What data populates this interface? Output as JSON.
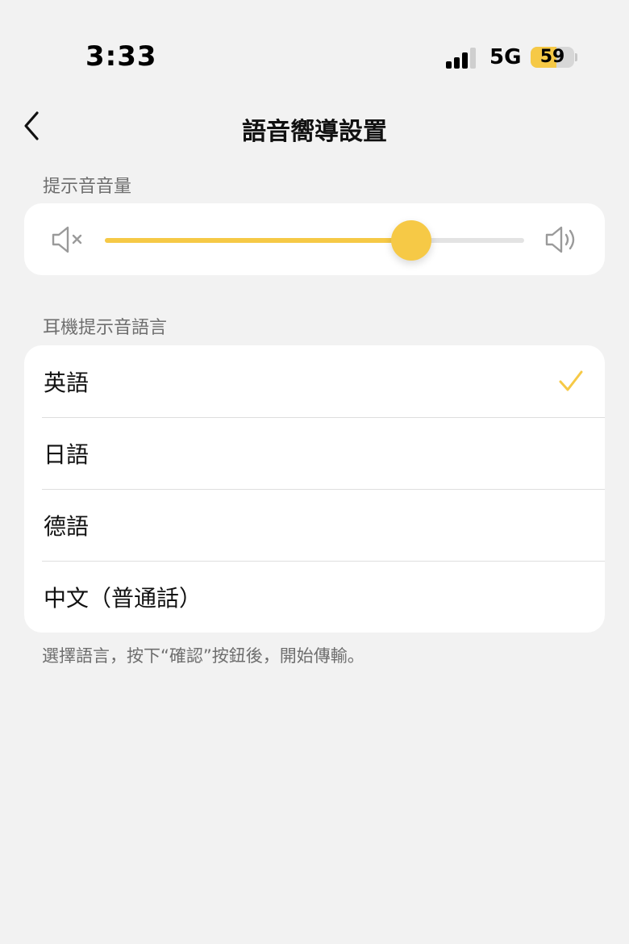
{
  "status_bar": {
    "time": "3:33",
    "network": "5G",
    "battery_level": "59",
    "battery_percent": 59
  },
  "nav": {
    "title": "語音嚮導設置",
    "back_icon": "chevron-left-icon"
  },
  "volume_section": {
    "label": "提示音音量",
    "mute_icon": "speaker-mute-icon",
    "loud_icon": "speaker-loud-icon",
    "volume_percent": 73
  },
  "language_section": {
    "label": "耳機提示音語言",
    "items": [
      {
        "label": "英語",
        "selected": true
      },
      {
        "label": "日語",
        "selected": false
      },
      {
        "label": "德語",
        "selected": false
      },
      {
        "label": "中文（普通話）",
        "selected": false
      }
    ],
    "footer": "選擇語言，按下“確認”按鈕後，開始傳輸。"
  },
  "colors": {
    "accent": "#f6c946",
    "background": "#f2f2f2",
    "card": "#ffffff",
    "secondary_text": "#6e6e6e"
  }
}
